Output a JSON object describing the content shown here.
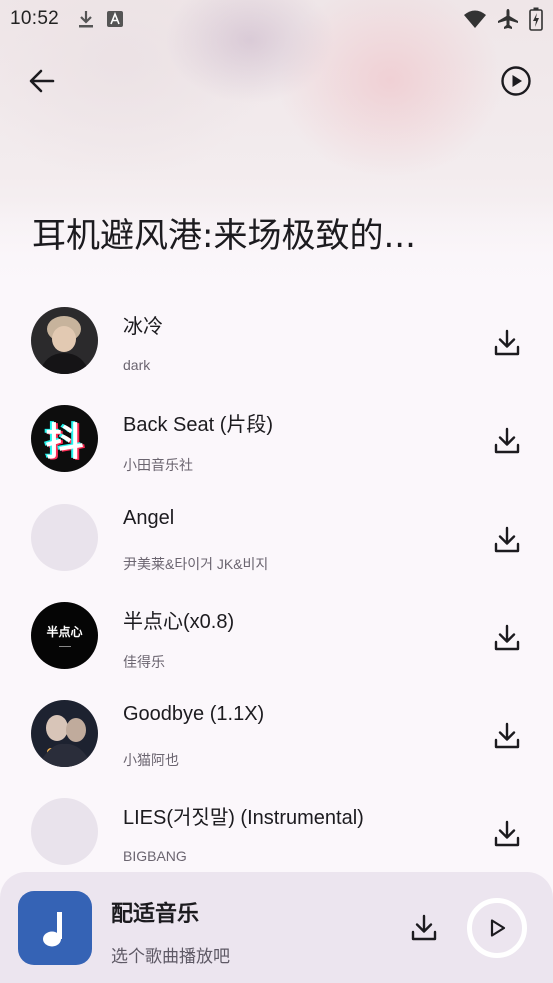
{
  "status_bar": {
    "time": "10:52",
    "icons": [
      "download-icon",
      "a-icon",
      "wifi-icon",
      "airplane-icon",
      "battery-charging-icon"
    ]
  },
  "header": {
    "back_icon": "arrow-back-icon",
    "play_all_icon": "play-circle-icon",
    "title": "耳机避风港:来场极致的..."
  },
  "songs": [
    {
      "title": "冰冷",
      "artist": "dark",
      "cover": "photo-portrait"
    },
    {
      "title": "Back Seat (片段)",
      "artist": "小田音乐社",
      "cover": "douyin-logo"
    },
    {
      "title": "Angel",
      "artist": "尹美莱&타이거 JK&비지",
      "cover": "placeholder"
    },
    {
      "title": "半点心(x0.8)",
      "artist": "佳得乐",
      "cover": "text-cover"
    },
    {
      "title": "Goodbye (1.1X)",
      "artist": "小猫阿也",
      "cover": "photo-night"
    },
    {
      "title": "LIES(거짓말) (Instrumental)",
      "artist": "BIGBANG",
      "cover": "placeholder"
    }
  ],
  "cover_texts": {
    "douyin": "抖",
    "banxin": "半点心"
  },
  "mini_player": {
    "title": "配适音乐",
    "subtitle": "选个歌曲播放吧",
    "cover_icon": "music-note-icon",
    "download_icon": "download-icon",
    "play_icon": "play-icon"
  },
  "colors": {
    "accent": "#3563b5",
    "background": "#fbf7fb",
    "player_bg": "#ece5ef"
  }
}
